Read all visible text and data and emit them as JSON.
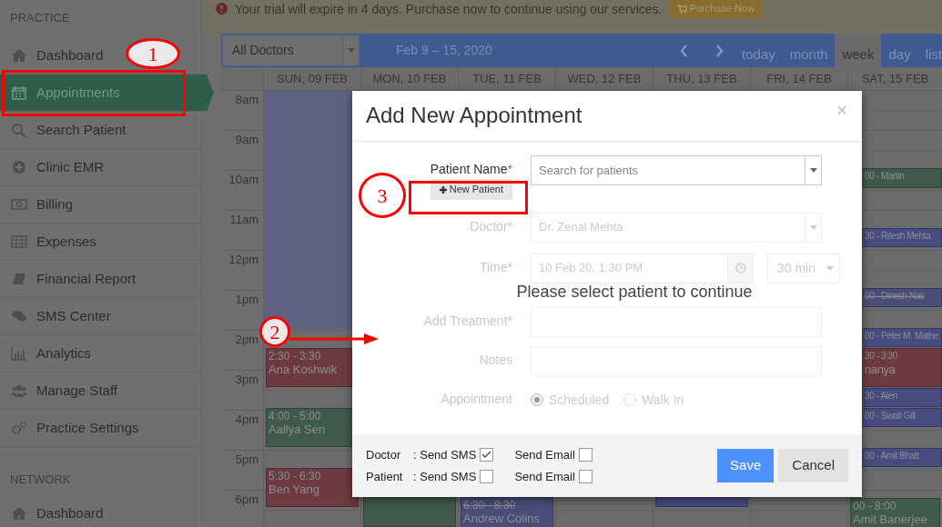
{
  "sidebar": {
    "sections": [
      {
        "heading": "PRACTICE",
        "items": [
          {
            "label": "Dashboard",
            "selected": false
          },
          {
            "label": "Appointments",
            "selected": true
          },
          {
            "label": "Search Patient",
            "selected": false
          },
          {
            "label": "Clinic EMR",
            "selected": false
          },
          {
            "label": "Billing",
            "selected": false
          },
          {
            "label": "Expenses",
            "selected": false
          },
          {
            "label": "Financial Report",
            "selected": false
          },
          {
            "label": "SMS Center",
            "selected": false
          },
          {
            "label": "Analytics",
            "selected": false
          },
          {
            "label": "Manage Staff",
            "selected": false
          },
          {
            "label": "Practice Settings",
            "selected": false
          }
        ]
      },
      {
        "heading": "NETWORK",
        "items": [
          {
            "label": "Dashboard",
            "selected": false
          }
        ]
      }
    ]
  },
  "banner": {
    "message": "Your trial will expire in 4 days. Purchase now to continue using our services.",
    "button": "Purchase Now"
  },
  "calendar": {
    "doctor_filter": "All Doctors",
    "range": "Feb 9 – 15, 2020",
    "today": "today",
    "views": [
      {
        "label": "month",
        "selected": false
      },
      {
        "label": "week",
        "selected": true
      },
      {
        "label": "day",
        "selected": false
      },
      {
        "label": "list",
        "selected": false
      }
    ],
    "hours": [
      "8am",
      "9am",
      "10am",
      "11am",
      "12pm",
      "1pm",
      "2pm",
      "3pm",
      "4pm",
      "5pm",
      "6pm"
    ],
    "columns": [
      {
        "day": "SUN, 09 FEB",
        "highlighted": true,
        "events": [
          {
            "time": "2:30 - 3:30",
            "name": "Ana Koshwik",
            "color": "#6c3a40",
            "cancelled": false
          },
          {
            "time": "4:00 - 5:00",
            "name": "Aallya Sen",
            "color": "#3f5a4a",
            "cancelled": false
          },
          {
            "time": "5:30 - 6:30",
            "name": "Ben Yang",
            "color": "#6c3a40",
            "cancelled": false
          }
        ]
      },
      {
        "day": "MON, 10 FEB",
        "highlighted": false,
        "events": [
          {
            "color": "#3f5a4a"
          }
        ]
      },
      {
        "day": "TUE, 11 FEB",
        "highlighted": false,
        "events": [
          {
            "time": "6:30 - 8:30",
            "name": "Andrew Colins",
            "color": "#4a4d7a",
            "cancelled": true
          }
        ]
      },
      {
        "day": "WED, 12 FEB"
      },
      {
        "day": "THU, 13 FEB",
        "events": [
          {
            "color": "#474b80"
          }
        ]
      },
      {
        "day": "FRI, 14 FEB"
      },
      {
        "day": "SAT, 15 FEB",
        "highlighted": false,
        "events": [
          {
            "time": "00 - Martin",
            "color": "#3f5a4a",
            "cancelled": false
          },
          {
            "time": "30 - Ritesh Mehta",
            "color": "#474b80",
            "cancelled": false
          },
          {
            "time": "00 - Dinesh Nair",
            "color": "#4a4d7a",
            "cancelled": true
          },
          {
            "time": "00 - Peter M. Mathe",
            "color": "#474b80",
            "cancelled": false
          },
          {
            "time": "30 - 3:30",
            "name": "nanya",
            "color": "#6c3a40",
            "cancelled": false
          },
          {
            "time": "30 - Alen",
            "color": "#474b80",
            "cancelled": false
          },
          {
            "time": "00 - Swati Gill",
            "color": "#474b80",
            "cancelled": false
          },
          {
            "time": "00 - Amit Bhatt",
            "color": "#474b80",
            "cancelled": false
          },
          {
            "time": "00 - 8:00",
            "name": "Amit Banerjee",
            "color": "#3f5a4a",
            "cancelled": false
          }
        ]
      }
    ]
  },
  "modal": {
    "title": "Add New Appointment",
    "close": "×",
    "rows": [
      {
        "kind": "select",
        "label": "Patient Name",
        "required_mark": "*",
        "disabled": false,
        "placeholder": "Search for patients",
        "action": "New Patient"
      },
      {
        "kind": "select",
        "label": "Doctor",
        "required_mark": "*",
        "disabled": true,
        "value": "Dr. Zenal Mehta"
      },
      {
        "kind": "time",
        "label": "Time",
        "required_mark": "*",
        "disabled": true,
        "value": "10 Feb 20, 1:30 PM",
        "duration": "30 min"
      },
      {
        "kind": "text",
        "label": "Add Treatment",
        "required_mark": "*",
        "disabled": true
      },
      {
        "kind": "text",
        "label": "Notes",
        "disabled": true
      },
      {
        "kind": "radio",
        "label": "Appointment",
        "disabled": true,
        "options": [
          {
            "label": "Scheduled",
            "selected": true
          },
          {
            "label": "Walk In",
            "selected": false
          }
        ]
      }
    ],
    "message": "Please select patient to continue",
    "notifications": [
      {
        "who": "Doctor",
        "sms_label": ": Send SMS",
        "sms": true,
        "email_label": "Send Email",
        "email": false
      },
      {
        "who": "Patient",
        "sms_label": ": Send SMS",
        "sms": false,
        "email_label": "Send Email",
        "email": false
      }
    ],
    "buttons": [
      {
        "label": "Save",
        "kind": "primary"
      },
      {
        "label": "Cancel",
        "kind": "secondary"
      }
    ]
  },
  "annotations": [
    {
      "label": "1"
    },
    {
      "label": "2"
    },
    {
      "label": "3"
    }
  ]
}
